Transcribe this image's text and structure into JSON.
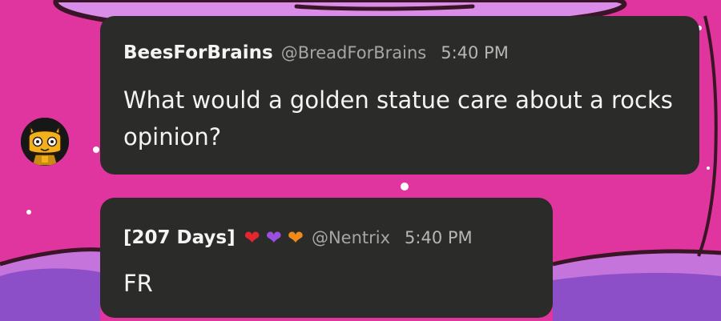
{
  "theme": {
    "background": "#e0349e",
    "bubble": "#2b2b29",
    "lavender": "#d98ce8",
    "purple": "#8c4fc8",
    "outline": "#3a1525"
  },
  "messages": [
    {
      "avatar_icon": "cat-avatar-icon",
      "author": "BeesForBrains",
      "handle": "@BreadForBrains",
      "time": "5:40 PM",
      "text": "What would a golden statue care about a rocks opinion?"
    },
    {
      "author": "[207 Days]",
      "hearts": [
        {
          "icon": "red-heart-icon",
          "glyph": "❤",
          "color": "#e3262f"
        },
        {
          "icon": "purple-heart-icon",
          "glyph": "❤",
          "color": "#9b4fe0"
        },
        {
          "icon": "orange-heart-icon",
          "glyph": "❤",
          "color": "#f28a1a"
        }
      ],
      "handle": "@Nentrix",
      "time": "5:40 PM",
      "text": "FR"
    }
  ]
}
